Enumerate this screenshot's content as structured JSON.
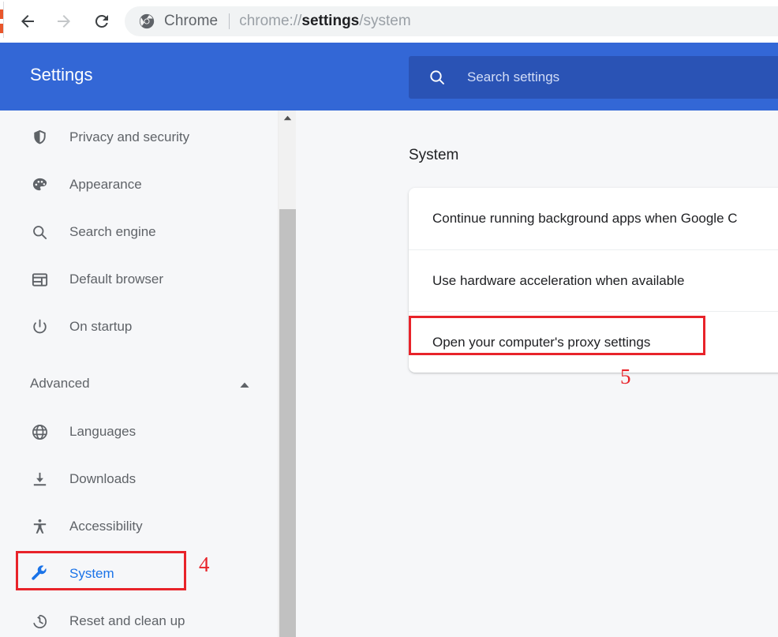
{
  "browser": {
    "back_icon": "arrow-left-icon",
    "forward_icon": "arrow-right-icon",
    "reload_icon": "reload-icon",
    "omnibox": {
      "brand_icon": "chrome-logo-icon",
      "brand_label": "Chrome",
      "url_prefix": "chrome://",
      "url_strong": "settings",
      "url_suffix": "/system"
    }
  },
  "header": {
    "title": "Settings",
    "search": {
      "icon": "search-icon",
      "placeholder": "Search settings",
      "value": ""
    },
    "bar_color": "#3367d6",
    "search_box_color": "#2a53b5"
  },
  "sidebar": {
    "items": [
      {
        "label": "Privacy and security",
        "icon": "shield-icon",
        "selected": false
      },
      {
        "label": "Appearance",
        "icon": "palette-icon",
        "selected": false
      },
      {
        "label": "Search engine",
        "icon": "search-icon",
        "selected": false
      },
      {
        "label": "Default browser",
        "icon": "browser-window-icon",
        "selected": false
      },
      {
        "label": "On startup",
        "icon": "power-icon",
        "selected": false
      }
    ],
    "advanced": {
      "label": "Advanced",
      "expanded": true,
      "chevron_icon": "chevron-up-icon",
      "items": [
        {
          "label": "Languages",
          "icon": "globe-icon",
          "selected": false
        },
        {
          "label": "Downloads",
          "icon": "download-icon",
          "selected": false
        },
        {
          "label": "Accessibility",
          "icon": "accessibility-icon",
          "selected": false
        },
        {
          "label": "System",
          "icon": "wrench-icon",
          "selected": true
        },
        {
          "label": "Reset and clean up",
          "icon": "history-icon",
          "selected": false
        }
      ]
    },
    "scrollbar": {
      "up_arrow_icon": "triangle-up-icon",
      "track_color": "#f1f1f1",
      "thumb_color": "#c1c1c1"
    },
    "selected_color": "#1a73e8"
  },
  "main": {
    "section_title": "System",
    "rows": [
      {
        "label": "Continue running background apps when Google C"
      },
      {
        "label": "Use hardware acceleration when available"
      },
      {
        "label": "Open your computer's proxy settings"
      }
    ]
  },
  "annotations": {
    "color": "#e8232a",
    "items": [
      {
        "number": "4",
        "target": "System sidebar item"
      },
      {
        "number": "5",
        "target": "Open your computer's proxy settings"
      }
    ],
    "num_4": "4",
    "num_5": "5"
  }
}
